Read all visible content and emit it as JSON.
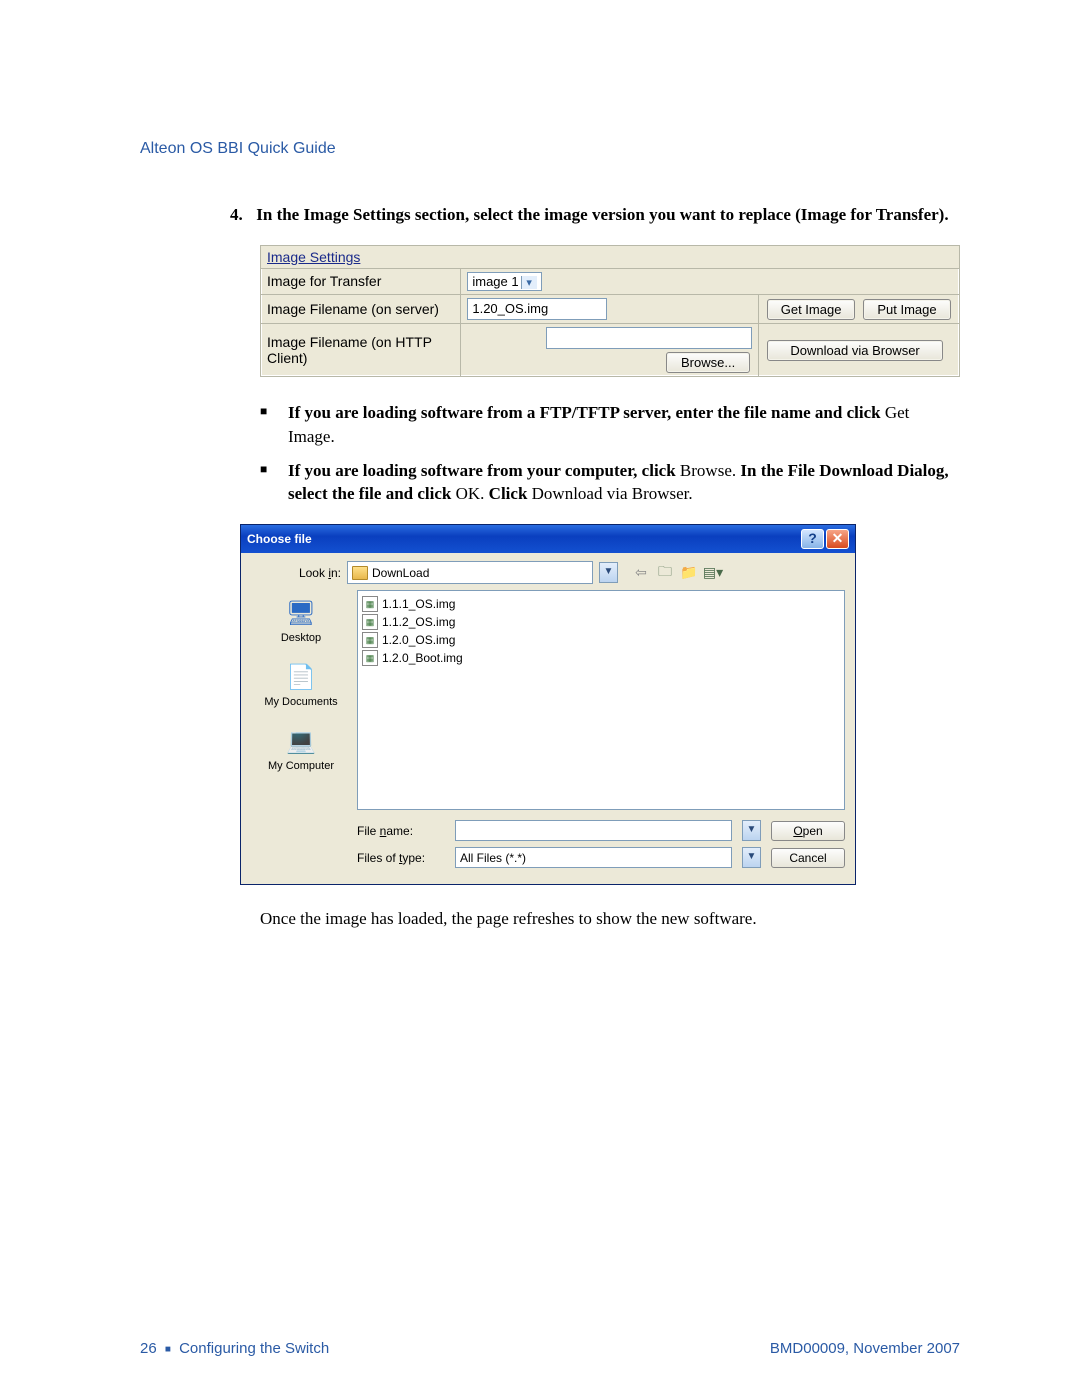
{
  "header": {
    "title": "Alteon OS  BBI Quick Guide"
  },
  "step": {
    "number": "4.",
    "text_bold": "In the Image Settings section, select the image version you want to replace (Image for Transfer)."
  },
  "image_settings": {
    "heading": "Image Settings",
    "row1_label": "Image for Transfer",
    "row1_value": "image 1",
    "row2_label": "Image Filename (on server)",
    "row2_value": "1.20_OS.img",
    "btn_get": "Get Image",
    "btn_put": "Put Image",
    "row3_label": "Image Filename (on HTTP Client)",
    "btn_browse": "Browse...",
    "btn_download": "Download via Browser"
  },
  "bullets": {
    "b1_bold": "If you are loading software from a FTP/TFTP server, enter the file name and click",
    "b1_tail": " Get Image.",
    "b2_part1": "If you are loading software from your computer, click ",
    "b2_browse": "Browse",
    "b2_part2": ". ",
    "b2_part3": "In the File Download Dialog, select the file and click ",
    "b2_ok": "OK",
    "b2_part4": ". ",
    "b2_part5": "Click ",
    "b2_dl": "Download via Browser."
  },
  "filedlg": {
    "title": "Choose file",
    "lookin_label": "Look in:",
    "lookin_value": "DownLoad",
    "files": [
      "1.1.1_OS.img",
      "1.1.2_OS.img",
      "1.2.0_OS.img",
      "1.2.0_Boot.img"
    ],
    "places": {
      "desktop": "Desktop",
      "docs": "My Documents",
      "comp": "My Computer"
    },
    "filename_label": "File name:",
    "filetype_label": "Files of type:",
    "filetype_value": "All Files (*.*)",
    "open_btn": "Open",
    "cancel_btn": "Cancel"
  },
  "final": "Once the image has loaded, the page refreshes to show the new software.",
  "footer": {
    "page": "26",
    "section": "Configuring the Switch",
    "right": "BMD00009, November 2007"
  }
}
